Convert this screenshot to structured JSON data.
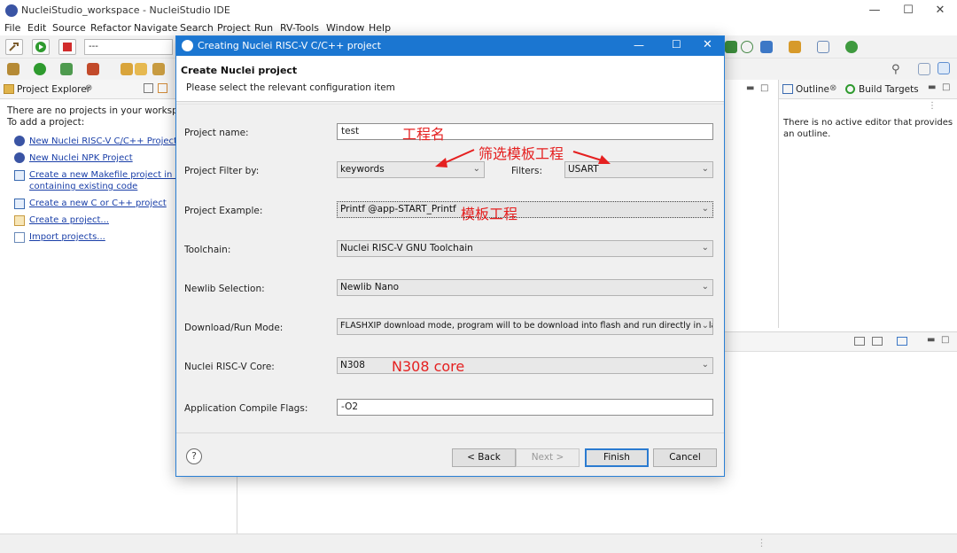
{
  "window": {
    "title": "NucleiStudio_workspace - NucleiStudio IDE"
  },
  "menubar": [
    "File",
    "Edit",
    "Source",
    "Refactor",
    "Navigate",
    "Search",
    "Project",
    "Run",
    "RV-Tools",
    "Window",
    "Help"
  ],
  "toolbar": {
    "launch_config_value": "---"
  },
  "left_panel": {
    "tab_label": "Project Explorer",
    "empty_line1": "There are no projects in your workspace.",
    "empty_line2": "To add a project:",
    "links": [
      {
        "label": "New Nuclei RISC-V C/C++ Project",
        "icon": "nuclei-logo-icon"
      },
      {
        "label": "New Nuclei NPK Project",
        "icon": "nuclei-logo-icon"
      },
      {
        "label": "Create a new Makefile project in a d",
        "label2": "containing existing code",
        "icon": "makefile-project-icon"
      },
      {
        "label": "Create a new C or C++ project",
        "icon": "c-project-icon"
      },
      {
        "label": "Create a project...",
        "icon": "folder-icon"
      },
      {
        "label": "Import projects...",
        "icon": "import-icon"
      }
    ]
  },
  "right_panel": {
    "tab_outline": "Outline",
    "tab_build_targets": "Build Targets",
    "message": "There is no active editor that provides an outline."
  },
  "dialog": {
    "title": "Creating Nuclei RISC-V C/C++ project",
    "header_title": "Create Nuclei project",
    "header_subtitle": "Please select the relevant configuration item",
    "fields": {
      "project_name": {
        "label": "Project name:",
        "value": "test"
      },
      "project_filter": {
        "label": "Project Filter by:",
        "value": "keywords"
      },
      "filters": {
        "label": "Filters:",
        "value": "USART"
      },
      "project_example": {
        "label": "Project Example:",
        "value": "Printf  @app-START_Printf"
      },
      "toolchain": {
        "label": "Toolchain:",
        "value": "Nuclei RISC-V GNU Toolchain"
      },
      "newlib": {
        "label": "Newlib Selection:",
        "value": "Newlib Nano"
      },
      "download_mode": {
        "label": "Download/Run Mode:",
        "value": "FLASHXIP download mode, program will to be download into flash and run directly in Fla"
      },
      "core": {
        "label": "Nuclei RISC-V Core:",
        "value": "N308"
      },
      "compile_flags": {
        "label": "Application Compile Flags:",
        "value": "-O2"
      }
    },
    "buttons": {
      "back": "< Back",
      "next": "Next >",
      "finish": "Finish",
      "cancel": "Cancel"
    },
    "help_glyph": "?"
  },
  "annotations": {
    "project_name_note": "工程名",
    "filter_note": "筛选模板工程",
    "example_note": "模板工程",
    "core_note": "N308 core",
    "color": "#e52020"
  },
  "colors": {
    "dialog_title_bg": "#1b76d1",
    "link": "#1a3fa8"
  }
}
